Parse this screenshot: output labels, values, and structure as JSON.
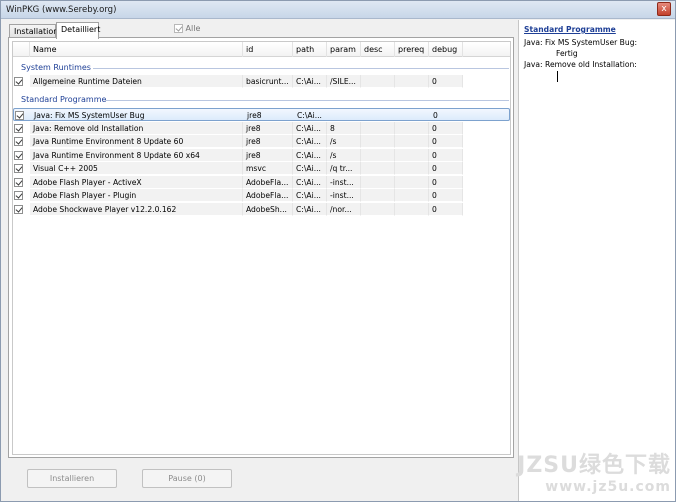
{
  "window": {
    "title": "WinPKG (www.Sereby.org)",
    "close_glyph": "x"
  },
  "tabs": [
    {
      "label": "Installation",
      "active": false
    },
    {
      "label": "Detailliert",
      "active": true
    }
  ],
  "alle": {
    "label": "Alle",
    "checked": true
  },
  "columns": [
    "Name",
    "id",
    "path",
    "param",
    "desc",
    "prereq",
    "debug"
  ],
  "groups": [
    {
      "title": "System Runtimes",
      "rows": [
        {
          "checked": true,
          "name": "Allgemeine Runtime Dateien",
          "id": "basicrunt...",
          "path": "C:\\Ai...",
          "param": "/SILE...",
          "desc": "",
          "prereq": "",
          "debug": "0"
        }
      ]
    },
    {
      "title": "Standard Programme",
      "rows": [
        {
          "checked": true,
          "name": "Java: Fix MS SystemUser Bug",
          "id": "jre8",
          "path": "C:\\Ai...",
          "param": "",
          "desc": "",
          "prereq": "",
          "debug": "0",
          "selected": true
        },
        {
          "checked": true,
          "name": "Java: Remove old Installation",
          "id": "jre8",
          "path": "C:\\Ai...",
          "param": "8",
          "desc": "",
          "prereq": "",
          "debug": "0"
        },
        {
          "checked": true,
          "name": "Java Runtime Environment 8 Update 60",
          "id": "jre8",
          "path": "C:\\Ai...",
          "param": "/s",
          "desc": "",
          "prereq": "",
          "debug": "0"
        },
        {
          "checked": true,
          "name": "Java Runtime Environment 8 Update 60 x64",
          "id": "jre8",
          "path": "C:\\Ai...",
          "param": "/s",
          "desc": "",
          "prereq": "",
          "debug": "0"
        },
        {
          "checked": true,
          "name": "Visual C++ 2005",
          "id": "msvc",
          "path": "C:\\Ai...",
          "param": "/q tr...",
          "desc": "",
          "prereq": "",
          "debug": "0"
        },
        {
          "checked": true,
          "name": "Adobe Flash Player - ActiveX",
          "id": "AdobeFla...",
          "path": "C:\\Ai...",
          "param": "-inst...",
          "desc": "",
          "prereq": "",
          "debug": "0"
        },
        {
          "checked": true,
          "name": "Adobe Flash Player - Plugin",
          "id": "AdobeFla...",
          "path": "C:\\Ai...",
          "param": "-inst...",
          "desc": "",
          "prereq": "",
          "debug": "0"
        },
        {
          "checked": true,
          "name": "Adobe Shockwave Player v12.2.0.162",
          "id": "AdobeSh...",
          "path": "C:\\Ai...",
          "param": "/nor...",
          "desc": "",
          "prereq": "",
          "debug": "0"
        }
      ]
    }
  ],
  "buttons": {
    "install": "Installieren",
    "pause": "Pause (0)"
  },
  "log": {
    "heading": "Standard Programme",
    "lines": [
      "Java: Fix MS SystemUser Bug:",
      "Fertig",
      "Java: Remove old Installation:"
    ]
  },
  "watermark": {
    "line1": "JZSU绿色下载",
    "line2": "www.jz5u.com"
  }
}
